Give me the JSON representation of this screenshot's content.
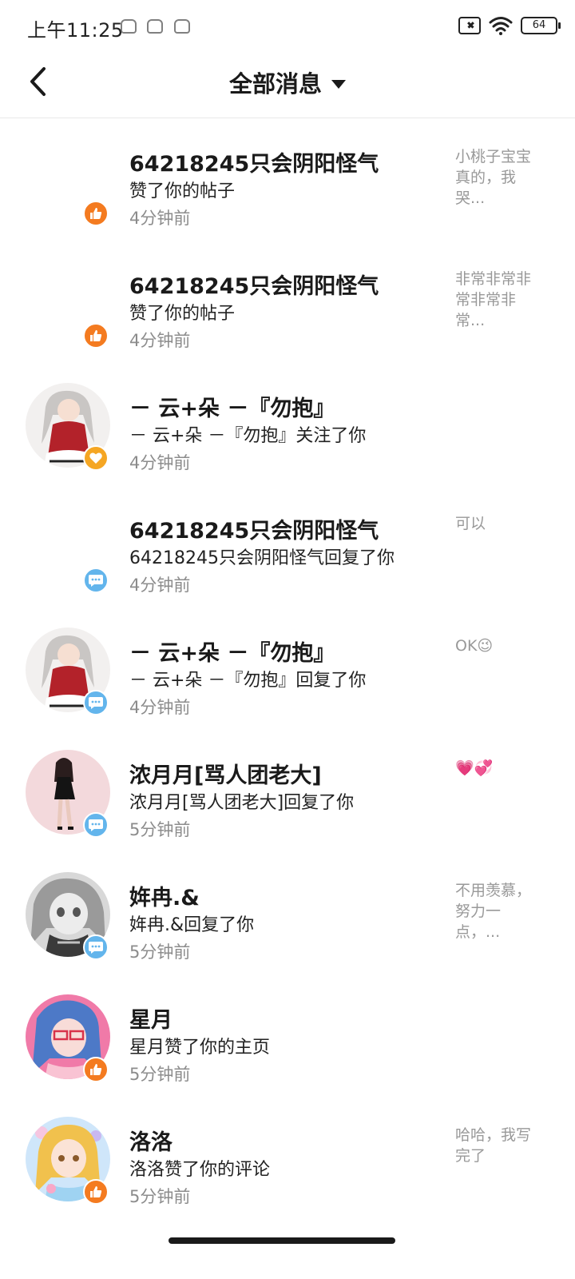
{
  "status_bar": {
    "time": "上午11:25",
    "battery": "64"
  },
  "header": {
    "title": "全部消息"
  },
  "colors": {
    "like_badge": "#f47b20",
    "follow_badge": "#f5a623",
    "reply_badge": "#63b5ec"
  },
  "messages": [
    {
      "name": "64218245只会阴阳怪气",
      "action": "赞了你的帖子",
      "time": "4分钟前",
      "preview": "小桃子宝宝真的，我哭...",
      "badge": "like",
      "avatar": "none"
    },
    {
      "name": "64218245只会阴阳怪气",
      "action": "赞了你的帖子",
      "time": "4分钟前",
      "preview": "非常非常非常非常非常...",
      "badge": "like",
      "avatar": "none"
    },
    {
      "name": "－ 云+朵 －『勿抱』",
      "action": "－ 云+朵 －『勿抱』关注了你",
      "time": "4分钟前",
      "preview": "",
      "badge": "follow",
      "avatar": "anime-girl-red-dress"
    },
    {
      "name": "64218245只会阴阳怪气",
      "action": "64218245只会阴阳怪气回复了你",
      "time": "4分钟前",
      "preview": "可以",
      "badge": "reply",
      "avatar": "none"
    },
    {
      "name": "－ 云+朵 －『勿抱』",
      "action": "－ 云+朵 －『勿抱』回复了你",
      "time": "4分钟前",
      "preview": "OK😉",
      "badge": "reply",
      "avatar": "anime-girl-red-dress"
    },
    {
      "name": "浓月月[骂人团老大]",
      "action": "浓月月[骂人团老大]回复了你",
      "time": "5分钟前",
      "preview": "💗💞",
      "badge": "reply",
      "avatar": "girl-black-dress-pink"
    },
    {
      "name": "姩冉.&",
      "action": "姩冉.&回复了你",
      "time": "5分钟前",
      "preview": "不用羡慕，努力一点，...",
      "badge": "reply",
      "avatar": "anime-grey-hair"
    },
    {
      "name": "星月",
      "action": "星月赞了你的主页",
      "time": "5分钟前",
      "preview": "",
      "badge": "like",
      "avatar": "anime-blue-hair-pink"
    },
    {
      "name": "洛洛",
      "action": "洛洛赞了你的评论",
      "time": "5分钟前",
      "preview": "哈哈，我写完了",
      "badge": "like",
      "avatar": "anime-blonde-pastel"
    }
  ]
}
